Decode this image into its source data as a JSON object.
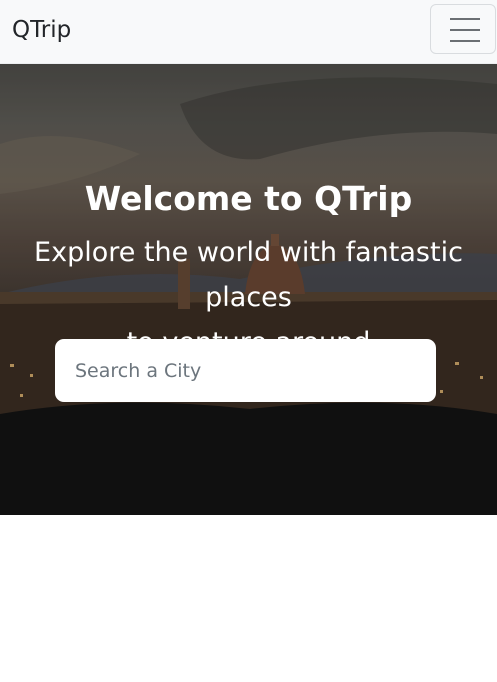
{
  "navbar": {
    "brand": "QTrip",
    "menu_icon": "hamburger-menu-icon"
  },
  "hero": {
    "title": "Welcome to QTrip",
    "subtitle_line1": "Explore the world with fantastic places",
    "subtitle_line2": "to venture around",
    "search": {
      "placeholder": "Search a City",
      "value": ""
    }
  },
  "colors": {
    "navbar_bg": "#f8f9fa",
    "brand_text": "#212529",
    "hero_text": "#ffffff",
    "search_bg": "#ffffff"
  }
}
